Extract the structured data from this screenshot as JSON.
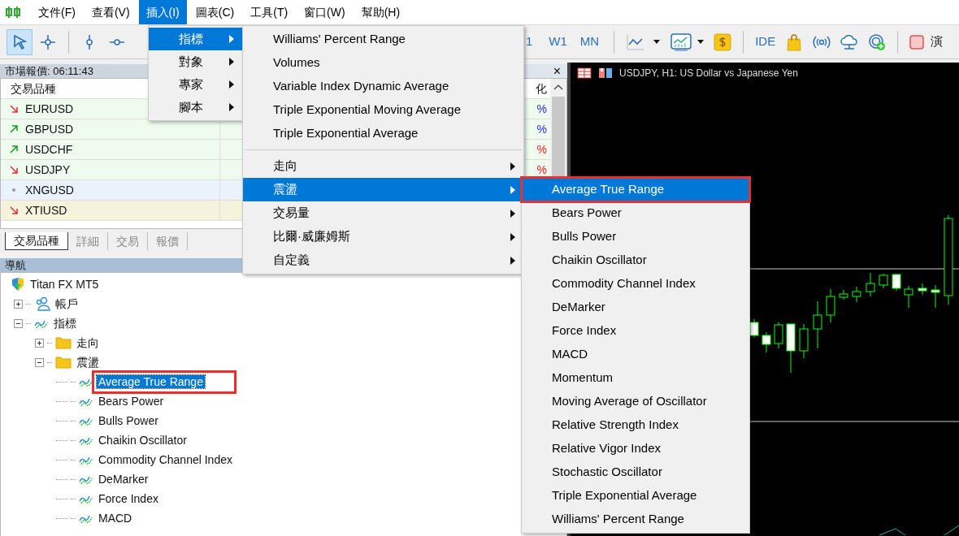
{
  "menubar": {
    "items": [
      {
        "label": "文件(F)",
        "selected": false
      },
      {
        "label": "查看(V)",
        "selected": false
      },
      {
        "label": "插入(I)",
        "selected": true
      },
      {
        "label": "圖表(C)",
        "selected": false
      },
      {
        "label": "工具(T)",
        "selected": false
      },
      {
        "label": "窗口(W)",
        "selected": false
      },
      {
        "label": "幫助(H)",
        "selected": false
      }
    ]
  },
  "toolbar": {
    "timeframes": [
      "1",
      "W1",
      "MN"
    ],
    "ide": "IDE",
    "trailing_label": "演"
  },
  "insert_menu": {
    "items": [
      {
        "label": "指標",
        "selected": true
      },
      {
        "label": "對象",
        "selected": false
      },
      {
        "label": "專家",
        "selected": false
      },
      {
        "label": "腳本",
        "selected": false
      }
    ]
  },
  "indicators_menu": {
    "items": [
      {
        "kind": "item",
        "label": "Williams' Percent Range",
        "selected": false
      },
      {
        "kind": "item",
        "label": "Volumes",
        "selected": false
      },
      {
        "kind": "item",
        "label": "Variable Index Dynamic Average",
        "selected": false
      },
      {
        "kind": "item",
        "label": "Triple Exponential Moving Average",
        "selected": false
      },
      {
        "kind": "item",
        "label": "Triple Exponential Average",
        "selected": false
      },
      {
        "kind": "separator"
      },
      {
        "kind": "submenu",
        "label": "走向",
        "selected": false
      },
      {
        "kind": "submenu",
        "label": "震盪",
        "selected": true
      },
      {
        "kind": "submenu",
        "label": "交易量",
        "selected": false
      },
      {
        "kind": "submenu",
        "label": "比爾·威廉姆斯",
        "selected": false
      },
      {
        "kind": "submenu",
        "label": "自定義",
        "selected": false
      }
    ]
  },
  "oscillators_menu": {
    "items": [
      {
        "label": "Average True Range",
        "selected": true,
        "highlighted": true
      },
      {
        "label": "Bears Power",
        "selected": false,
        "highlighted": false
      },
      {
        "label": "Bulls Power",
        "selected": false,
        "highlighted": false
      },
      {
        "label": "Chaikin Oscillator",
        "selected": false,
        "highlighted": false
      },
      {
        "label": "Commodity Channel Index",
        "selected": false,
        "highlighted": false
      },
      {
        "label": "DeMarker",
        "selected": false,
        "highlighted": false
      },
      {
        "label": "Force Index",
        "selected": false,
        "highlighted": false
      },
      {
        "label": "MACD",
        "selected": false,
        "highlighted": false
      },
      {
        "label": "Momentum",
        "selected": false,
        "highlighted": false
      },
      {
        "label": "Moving Average of Oscillator",
        "selected": false,
        "highlighted": false
      },
      {
        "label": "Relative Strength Index",
        "selected": false,
        "highlighted": false
      },
      {
        "label": "Relative Vigor Index",
        "selected": false,
        "highlighted": false
      },
      {
        "label": "Stochastic Oscillator",
        "selected": false,
        "highlighted": false
      },
      {
        "label": "Triple Exponential Average",
        "selected": false,
        "highlighted": false
      },
      {
        "label": "Williams' Percent Range",
        "selected": false,
        "highlighted": false
      }
    ]
  },
  "market_watch": {
    "title": "市場報價: 06:11:43",
    "close": "×",
    "columns": [
      "交易品種",
      "化"
    ],
    "rows": [
      {
        "symbol": "EURUSD",
        "kind": "down",
        "color": "#eefbee",
        "change": {
          "text": "%",
          "color": "#2a2aff"
        }
      },
      {
        "symbol": "GBPUSD",
        "kind": "up",
        "color": "#eefbee",
        "change": {
          "text": "%",
          "color": "#2a2aff"
        }
      },
      {
        "symbol": "USDCHF",
        "kind": "up",
        "color": "#eefbee",
        "change": {
          "text": "%",
          "color": "#ff2020"
        }
      },
      {
        "symbol": "USDJPY",
        "kind": "down",
        "color": "#eefbee",
        "change": {
          "text": "%",
          "color": "#ff2020"
        }
      },
      {
        "symbol": "XNGUSD",
        "kind": "flat",
        "color": "#eaf3fc"
      },
      {
        "symbol": "XTIUSD",
        "kind": "down",
        "color": "#f6f3dc"
      }
    ],
    "tabs": [
      {
        "label": "交易品種",
        "selected": true
      },
      {
        "label": "詳細",
        "selected": false
      },
      {
        "label": "交易",
        "selected": false
      },
      {
        "label": "報價",
        "selected": false
      }
    ]
  },
  "navigator": {
    "title": "導航",
    "tree": [
      {
        "label": "Titan FX MT5",
        "kind": "root",
        "children": [
          {
            "label": "帳戶",
            "kind": "accounts",
            "expanded": false
          },
          {
            "label": "指標",
            "kind": "indicators",
            "expanded": true,
            "children": [
              {
                "label": "走向",
                "kind": "folder",
                "expanded": false
              },
              {
                "label": "震盪",
                "kind": "folder",
                "expanded": true,
                "children": [
                  {
                    "label": "Average True Range",
                    "kind": "indicator",
                    "selected": true,
                    "highlighted": true
                  },
                  {
                    "label": "Bears Power",
                    "kind": "indicator",
                    "selected": false,
                    "highlighted": false
                  },
                  {
                    "label": "Bulls Power",
                    "kind": "indicator",
                    "selected": false,
                    "highlighted": false
                  },
                  {
                    "label": "Chaikin Oscillator",
                    "kind": "indicator",
                    "selected": false,
                    "highlighted": false
                  },
                  {
                    "label": "Commodity Channel Index",
                    "kind": "indicator",
                    "selected": false,
                    "highlighted": false
                  },
                  {
                    "label": "DeMarker",
                    "kind": "indicator",
                    "selected": false,
                    "highlighted": false
                  },
                  {
                    "label": "Force Index",
                    "kind": "indicator",
                    "selected": false,
                    "highlighted": false
                  },
                  {
                    "label": "MACD",
                    "kind": "indicator",
                    "selected": false,
                    "highlighted": false
                  }
                ]
              }
            ]
          }
        ]
      }
    ]
  },
  "chart": {
    "title": "USDJPY, H1:  US Dollar vs Japanese Yen"
  }
}
